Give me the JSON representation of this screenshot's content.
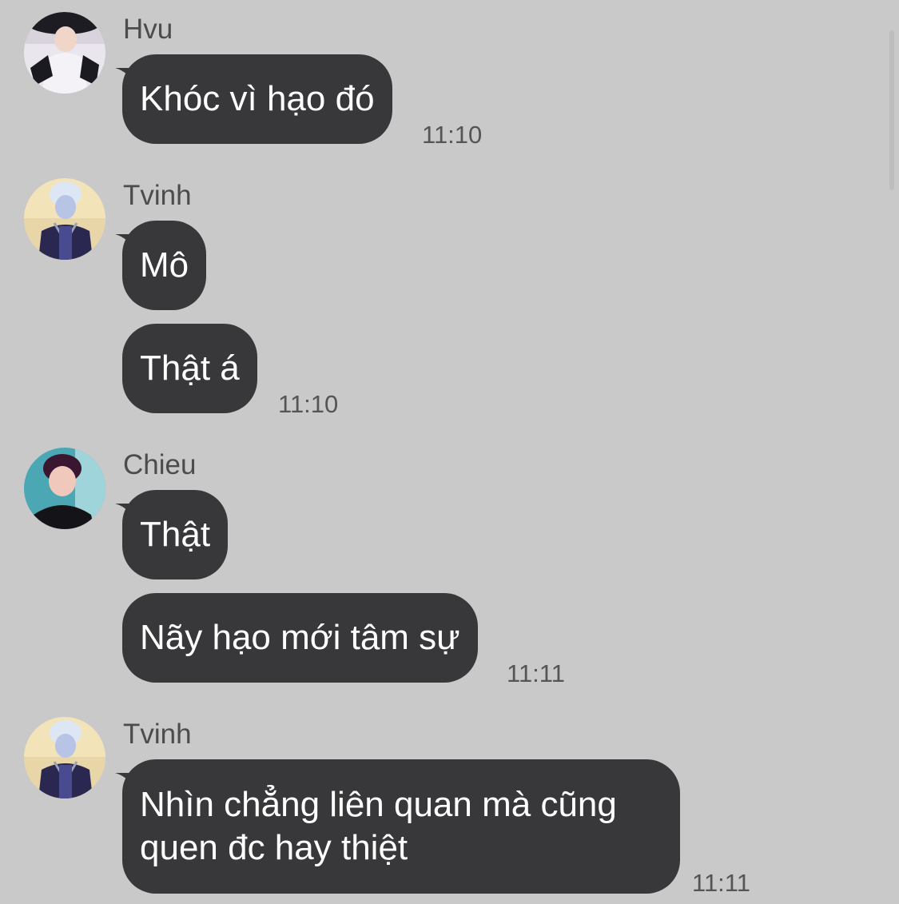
{
  "messages": [
    {
      "sender": "Hvu",
      "avatar": "avatar-hvu",
      "bubbles": [
        "Khóc vì hạo đó"
      ],
      "time": "11:10"
    },
    {
      "sender": "Tvinh",
      "avatar": "avatar-tvinh",
      "bubbles": [
        "Mô",
        "Thật á"
      ],
      "time": "11:10"
    },
    {
      "sender": "Chieu",
      "avatar": "avatar-chieu",
      "bubbles": [
        "Thật",
        "Nãy hạo mới tâm sự"
      ],
      "time": "11:11"
    },
    {
      "sender": "Tvinh",
      "avatar": "avatar-tvinh",
      "bubbles": [
        "Nhìn chẳng liên quan mà cũng quen đc hay thiệt"
      ],
      "time": "11:11"
    }
  ],
  "colors": {
    "background": "#c9c9c9",
    "bubble": "#38383a",
    "bubble_text": "#ffffff",
    "meta_text": "#4c4c4c"
  }
}
